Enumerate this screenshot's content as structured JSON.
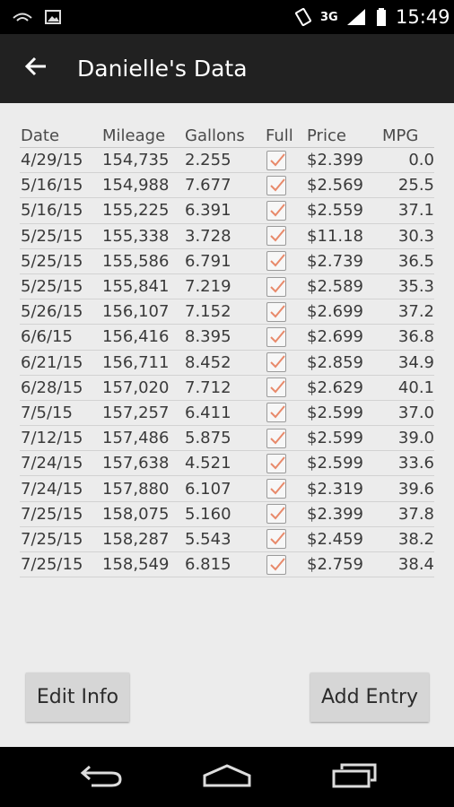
{
  "status_bar": {
    "network": "3G",
    "time": "15:49",
    "icons": [
      "wifi-icon",
      "image-icon",
      "rotate-icon",
      "signal-icon",
      "battery-icon"
    ]
  },
  "app_bar": {
    "title": "Danielle's Data",
    "back_icon": "arrow-back-icon"
  },
  "table": {
    "headers": {
      "date": "Date",
      "mileage": "Mileage",
      "gallons": "Gallons",
      "full": "Full",
      "price": "Price",
      "mpg": "MPG"
    },
    "rows": [
      {
        "date": "4/29/15",
        "mileage": "154,735",
        "gallons": "2.255",
        "full": true,
        "price": "$2.399",
        "mpg": "0.0"
      },
      {
        "date": "5/16/15",
        "mileage": "154,988",
        "gallons": "7.677",
        "full": true,
        "price": "$2.569",
        "mpg": "25.5"
      },
      {
        "date": "5/16/15",
        "mileage": "155,225",
        "gallons": "6.391",
        "full": true,
        "price": "$2.559",
        "mpg": "37.1"
      },
      {
        "date": "5/25/15",
        "mileage": "155,338",
        "gallons": "3.728",
        "full": true,
        "price": "$11.18",
        "mpg": "30.3"
      },
      {
        "date": "5/25/15",
        "mileage": "155,586",
        "gallons": "6.791",
        "full": true,
        "price": "$2.739",
        "mpg": "36.5"
      },
      {
        "date": "5/25/15",
        "mileage": "155,841",
        "gallons": "7.219",
        "full": true,
        "price": "$2.589",
        "mpg": "35.3"
      },
      {
        "date": "5/26/15",
        "mileage": "156,107",
        "gallons": "7.152",
        "full": true,
        "price": "$2.699",
        "mpg": "37.2"
      },
      {
        "date": "6/6/15",
        "mileage": "156,416",
        "gallons": "8.395",
        "full": true,
        "price": "$2.699",
        "mpg": "36.8"
      },
      {
        "date": "6/21/15",
        "mileage": "156,711",
        "gallons": "8.452",
        "full": true,
        "price": "$2.859",
        "mpg": "34.9"
      },
      {
        "date": "6/28/15",
        "mileage": "157,020",
        "gallons": "7.712",
        "full": true,
        "price": "$2.629",
        "mpg": "40.1"
      },
      {
        "date": "7/5/15",
        "mileage": "157,257",
        "gallons": "6.411",
        "full": true,
        "price": "$2.599",
        "mpg": "37.0"
      },
      {
        "date": "7/12/15",
        "mileage": "157,486",
        "gallons": "5.875",
        "full": true,
        "price": "$2.599",
        "mpg": "39.0"
      },
      {
        "date": "7/24/15",
        "mileage": "157,638",
        "gallons": "4.521",
        "full": true,
        "price": "$2.599",
        "mpg": "33.6"
      },
      {
        "date": "7/24/15",
        "mileage": "157,880",
        "gallons": "6.107",
        "full": true,
        "price": "$2.319",
        "mpg": "39.6"
      },
      {
        "date": "7/25/15",
        "mileage": "158,075",
        "gallons": "5.160",
        "full": true,
        "price": "$2.399",
        "mpg": "37.8"
      },
      {
        "date": "7/25/15",
        "mileage": "158,287",
        "gallons": "5.543",
        "full": true,
        "price": "$2.459",
        "mpg": "38.2"
      },
      {
        "date": "7/25/15",
        "mileage": "158,549",
        "gallons": "6.815",
        "full": true,
        "price": "$2.759",
        "mpg": "38.4"
      }
    ]
  },
  "buttons": {
    "edit_info": "Edit Info",
    "add_entry": "Add Entry"
  },
  "nav_bar": {
    "icons": [
      "nav-back-icon",
      "nav-home-icon",
      "nav-recent-apps-icon"
    ]
  },
  "colors": {
    "app_bar": "#212121",
    "background": "#ececec",
    "checkmark": "#e8896a",
    "button": "#d6d6d6"
  }
}
